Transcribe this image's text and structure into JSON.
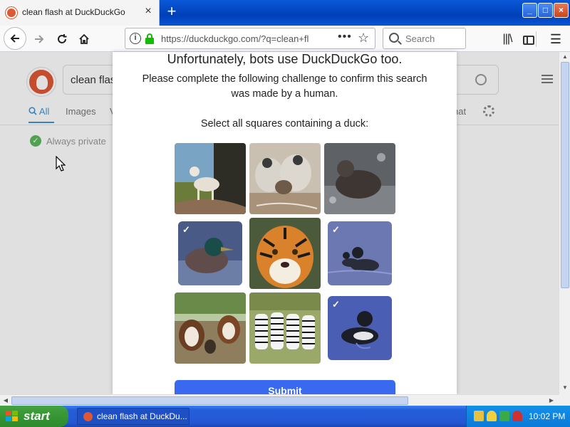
{
  "browser": {
    "tab_title": "clean flash at DuckDuckGo",
    "tab_close": "×",
    "new_tab": "+",
    "url": "https://duckduckgo.com/?q=clean+fl",
    "url_more": "•••",
    "search_placeholder": "Search",
    "window_minimize": "_",
    "window_maximize": "□",
    "window_close": "×"
  },
  "background_page": {
    "search_query": "clean flas",
    "tabs": [
      "All",
      "Images",
      "V",
      "hat"
    ],
    "always_private": "Always private"
  },
  "challenge": {
    "title": "Unfortunately, bots use DuckDuckGo too.",
    "subtitle": "Please complete the following challenge to confirm this search was made by a human.",
    "instruction": "Select all squares containing a duck:",
    "tiles": [
      {
        "subject": "cat",
        "selected": false
      },
      {
        "subject": "monkeys",
        "selected": false
      },
      {
        "subject": "seal",
        "selected": false
      },
      {
        "subject": "duck",
        "selected": true
      },
      {
        "subject": "tiger",
        "selected": false
      },
      {
        "subject": "duck",
        "selected": true
      },
      {
        "subject": "dogs",
        "selected": false
      },
      {
        "subject": "zebras",
        "selected": false
      },
      {
        "subject": "duck",
        "selected": true
      }
    ],
    "check_mark": "✓",
    "submit_label": "Submit"
  },
  "taskbar": {
    "start_label": "start",
    "task_label": "clean flash at DuckDu...",
    "clock": "10:02 PM"
  },
  "colors": {
    "accent": "#3969ef",
    "ddg_orange": "#de5833",
    "lock_green": "#12bc00"
  }
}
